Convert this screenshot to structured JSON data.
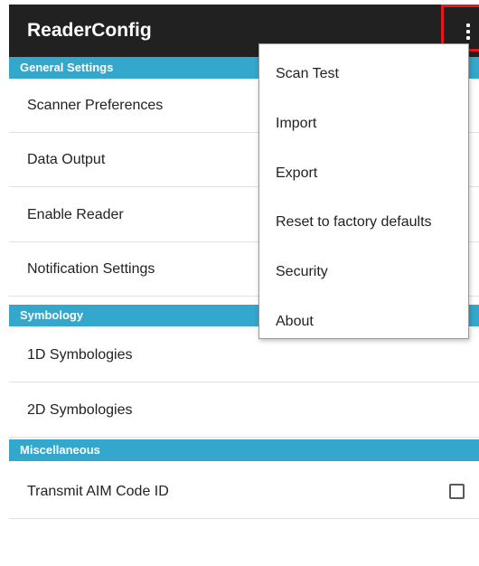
{
  "app_bar": {
    "title": "ReaderConfig",
    "overflow_icon": "more-vertical-icon",
    "highlight_color": "#e8161b",
    "background_color": "#212121"
  },
  "accent_color": "#33a7cc",
  "sections": [
    {
      "header": "General Settings",
      "items": [
        {
          "label": "Scanner Preferences"
        },
        {
          "label": "Data Output"
        },
        {
          "label": "Enable Reader"
        },
        {
          "label": "Notification Settings"
        }
      ]
    },
    {
      "header": "Symbology",
      "items": [
        {
          "label": "1D Symbologies"
        },
        {
          "label": "2D Symbologies"
        }
      ]
    },
    {
      "header": "Miscellaneous",
      "items": [
        {
          "label": "Transmit AIM Code ID",
          "checked": false
        }
      ]
    }
  ],
  "overflow_menu": {
    "items": [
      {
        "label": "Scan Test"
      },
      {
        "label": "Import"
      },
      {
        "label": "Export"
      },
      {
        "label": "Reset to factory defaults"
      },
      {
        "label": "Security"
      },
      {
        "label": "About"
      }
    ]
  }
}
